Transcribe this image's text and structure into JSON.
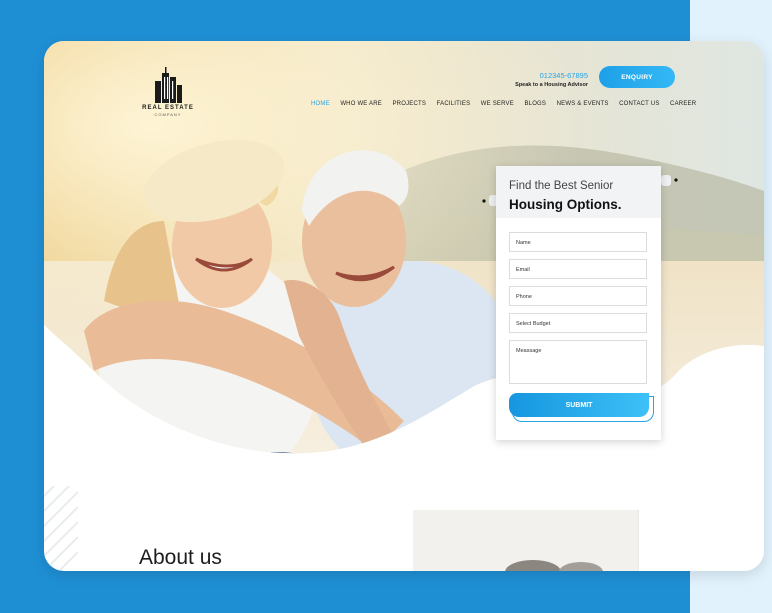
{
  "colors": {
    "outer_background": "#1f8fd4",
    "accent_blue": "#28a4e4",
    "pale_blue": "#e1f2fd",
    "card_background": "#ffffff"
  },
  "header": {
    "logo": {
      "brand": "REAL ESTATE",
      "tagline": "COMPANY",
      "icon": "building-icon"
    },
    "phone": {
      "number": "012345-67895",
      "caption": "Speak to a Housing Advisor"
    },
    "enquiry_label": "ENQUIRY"
  },
  "nav": {
    "items": [
      {
        "label": "HOME",
        "active": true
      },
      {
        "label": "WHO WE ARE",
        "active": false
      },
      {
        "label": "PROJECTS",
        "active": false
      },
      {
        "label": "FACILITIES",
        "active": false
      },
      {
        "label": "WE SERVE",
        "active": false
      },
      {
        "label": "BLOGS",
        "active": false
      },
      {
        "label": "NEWS & EVENTS",
        "active": false
      },
      {
        "label": "CONTACT US",
        "active": false
      },
      {
        "label": "CAREER",
        "active": false
      }
    ]
  },
  "hero": {
    "image": "senior-couple-photo"
  },
  "form": {
    "title_line1": "Find the Best Senior",
    "title_line2": "Housing Options.",
    "fields": {
      "name": "Name",
      "email": "Email",
      "phone": "Phone",
      "budget": "Select Budget",
      "message": "Meassage"
    },
    "submit_label": "SUBMIT"
  },
  "about": {
    "heading": "About us"
  }
}
